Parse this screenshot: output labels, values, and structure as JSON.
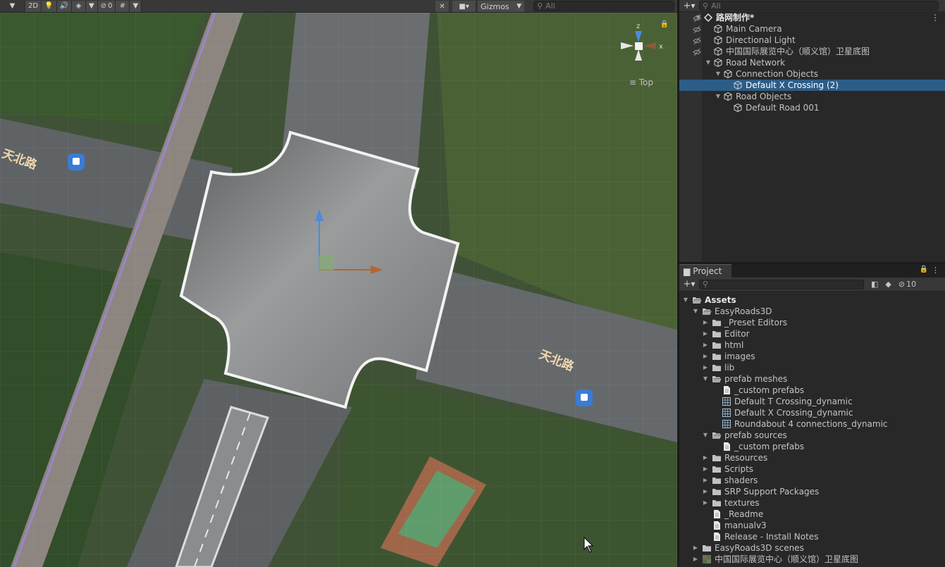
{
  "scene": {
    "toolbar": {
      "mode_2d": "2D",
      "hidden_count": "0",
      "gizmos_label": "Gizmos",
      "search_placeholder": "All"
    },
    "map_labels": {
      "road_left": "天北路",
      "road_right": "天北路"
    },
    "axis": {
      "z": "z",
      "x": "x"
    },
    "view_label": "Top"
  },
  "hierarchy": {
    "search_placeholder": "All",
    "items": [
      {
        "label": "路网制作*",
        "depth": 0,
        "expanded": true,
        "icon": "unity-scene-icon",
        "bold": true
      },
      {
        "label": "Main Camera",
        "depth": 1,
        "icon": "gameobject-cube-icon"
      },
      {
        "label": "Directional Light",
        "depth": 1,
        "icon": "gameobject-cube-icon"
      },
      {
        "label": "中国国际展览中心（顺义馆）卫星底图",
        "depth": 1,
        "icon": "gameobject-cube-icon"
      },
      {
        "label": "Road Network",
        "depth": 1,
        "expanded": true,
        "icon": "gameobject-cube-icon"
      },
      {
        "label": "Connection Objects",
        "depth": 2,
        "expanded": true,
        "icon": "gameobject-cube-icon"
      },
      {
        "label": "Default X Crossing (2)",
        "depth": 3,
        "icon": "gameobject-cube-icon",
        "selected": true
      },
      {
        "label": "Road Objects",
        "depth": 2,
        "expanded": true,
        "icon": "gameobject-cube-icon"
      },
      {
        "label": "Default Road 001",
        "depth": 3,
        "icon": "gameobject-cube-icon"
      }
    ]
  },
  "project": {
    "tab_label": "Project",
    "hidden_count": "10",
    "items": [
      {
        "label": "Assets",
        "depth": 0,
        "type": "folder",
        "expanded": true,
        "bold": true
      },
      {
        "label": "EasyRoads3D",
        "depth": 1,
        "type": "folder",
        "expanded": true
      },
      {
        "label": "_Preset Editors",
        "depth": 2,
        "type": "folder",
        "collapsed": true
      },
      {
        "label": "Editor",
        "depth": 2,
        "type": "folder",
        "collapsed": true
      },
      {
        "label": "html",
        "depth": 2,
        "type": "folder",
        "collapsed": true
      },
      {
        "label": "images",
        "depth": 2,
        "type": "folder",
        "collapsed": true
      },
      {
        "label": "lib",
        "depth": 2,
        "type": "folder",
        "collapsed": true
      },
      {
        "label": "prefab meshes",
        "depth": 2,
        "type": "folder",
        "expanded": true
      },
      {
        "label": "_custom prefabs",
        "depth": 3,
        "type": "file"
      },
      {
        "label": "Default T Crossing_dynamic",
        "depth": 3,
        "type": "mesh"
      },
      {
        "label": "Default X Crossing_dynamic",
        "depth": 3,
        "type": "mesh"
      },
      {
        "label": "Roundabout 4 connections_dynamic",
        "depth": 3,
        "type": "mesh"
      },
      {
        "label": "prefab sources",
        "depth": 2,
        "type": "folder",
        "expanded": true
      },
      {
        "label": "_custom prefabs",
        "depth": 3,
        "type": "file"
      },
      {
        "label": "Resources",
        "depth": 2,
        "type": "folder",
        "collapsed": true
      },
      {
        "label": "Scripts",
        "depth": 2,
        "type": "folder",
        "collapsed": true
      },
      {
        "label": "shaders",
        "depth": 2,
        "type": "folder",
        "collapsed": true
      },
      {
        "label": "SRP Support Packages",
        "depth": 2,
        "type": "folder",
        "collapsed": true
      },
      {
        "label": "textures",
        "depth": 2,
        "type": "folder",
        "collapsed": true
      },
      {
        "label": "_Readme",
        "depth": 2,
        "type": "file"
      },
      {
        "label": "manualv3",
        "depth": 2,
        "type": "file"
      },
      {
        "label": "Release - Install Notes",
        "depth": 2,
        "type": "file"
      },
      {
        "label": "EasyRoads3D scenes",
        "depth": 1,
        "type": "folder",
        "collapsed": true
      },
      {
        "label": "中国国际展览中心（顺义馆）卫星底图",
        "depth": 1,
        "type": "texture",
        "collapsed": true
      }
    ]
  },
  "colors": {
    "selection": "#2c5d87",
    "panel_bg": "#282828",
    "toolbar_bg": "#383838",
    "axis_y": "#4b8be0",
    "axis_x": "#b5652c"
  }
}
